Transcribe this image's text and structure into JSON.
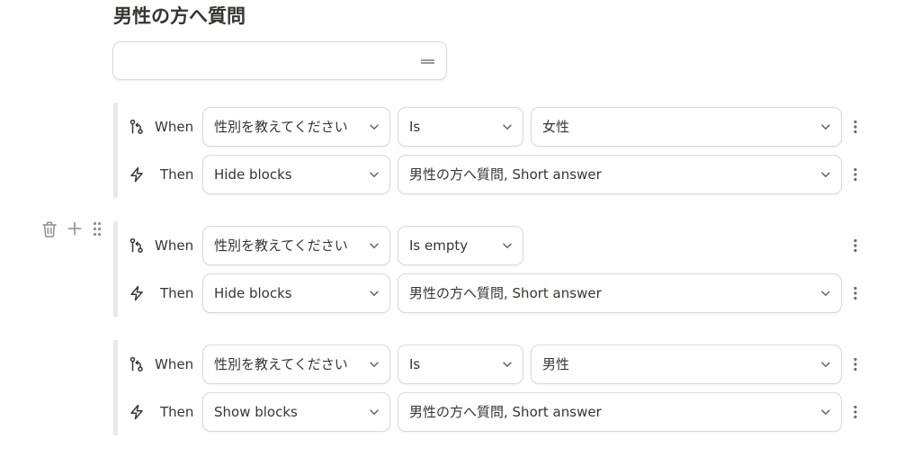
{
  "block": {
    "title": "男性の方へ質問",
    "answer_value": ""
  },
  "rules": [
    {
      "when_label": "When",
      "then_label": "Then",
      "field": "性別を教えてください",
      "operator": "Is",
      "value": "女性",
      "action": "Hide blocks",
      "target_blocks": "男性の方へ質問, Short answer"
    },
    {
      "when_label": "When",
      "then_label": "Then",
      "field": "性別を教えてください",
      "operator": "Is empty",
      "value": "",
      "action": "Hide blocks",
      "target_blocks": "男性の方へ質問, Short answer"
    },
    {
      "when_label": "When",
      "then_label": "Then",
      "field": "性別を教えてください",
      "operator": "Is",
      "value": "男性",
      "action": "Show blocks",
      "target_blocks": "男性の方へ質問, Short answer"
    }
  ],
  "icons": {
    "condition": "branch-icon",
    "action": "lightning-icon",
    "dropdown": "chevron-down-icon",
    "more": "more-vertical-icon",
    "delete": "trash-icon",
    "add": "plus-icon",
    "drag": "drag-handle-icon"
  },
  "colors": {
    "border": "#d9d9d6",
    "rule_bar": "#e9e9e7",
    "text": "#37352f",
    "icon": "#9b9a97"
  }
}
